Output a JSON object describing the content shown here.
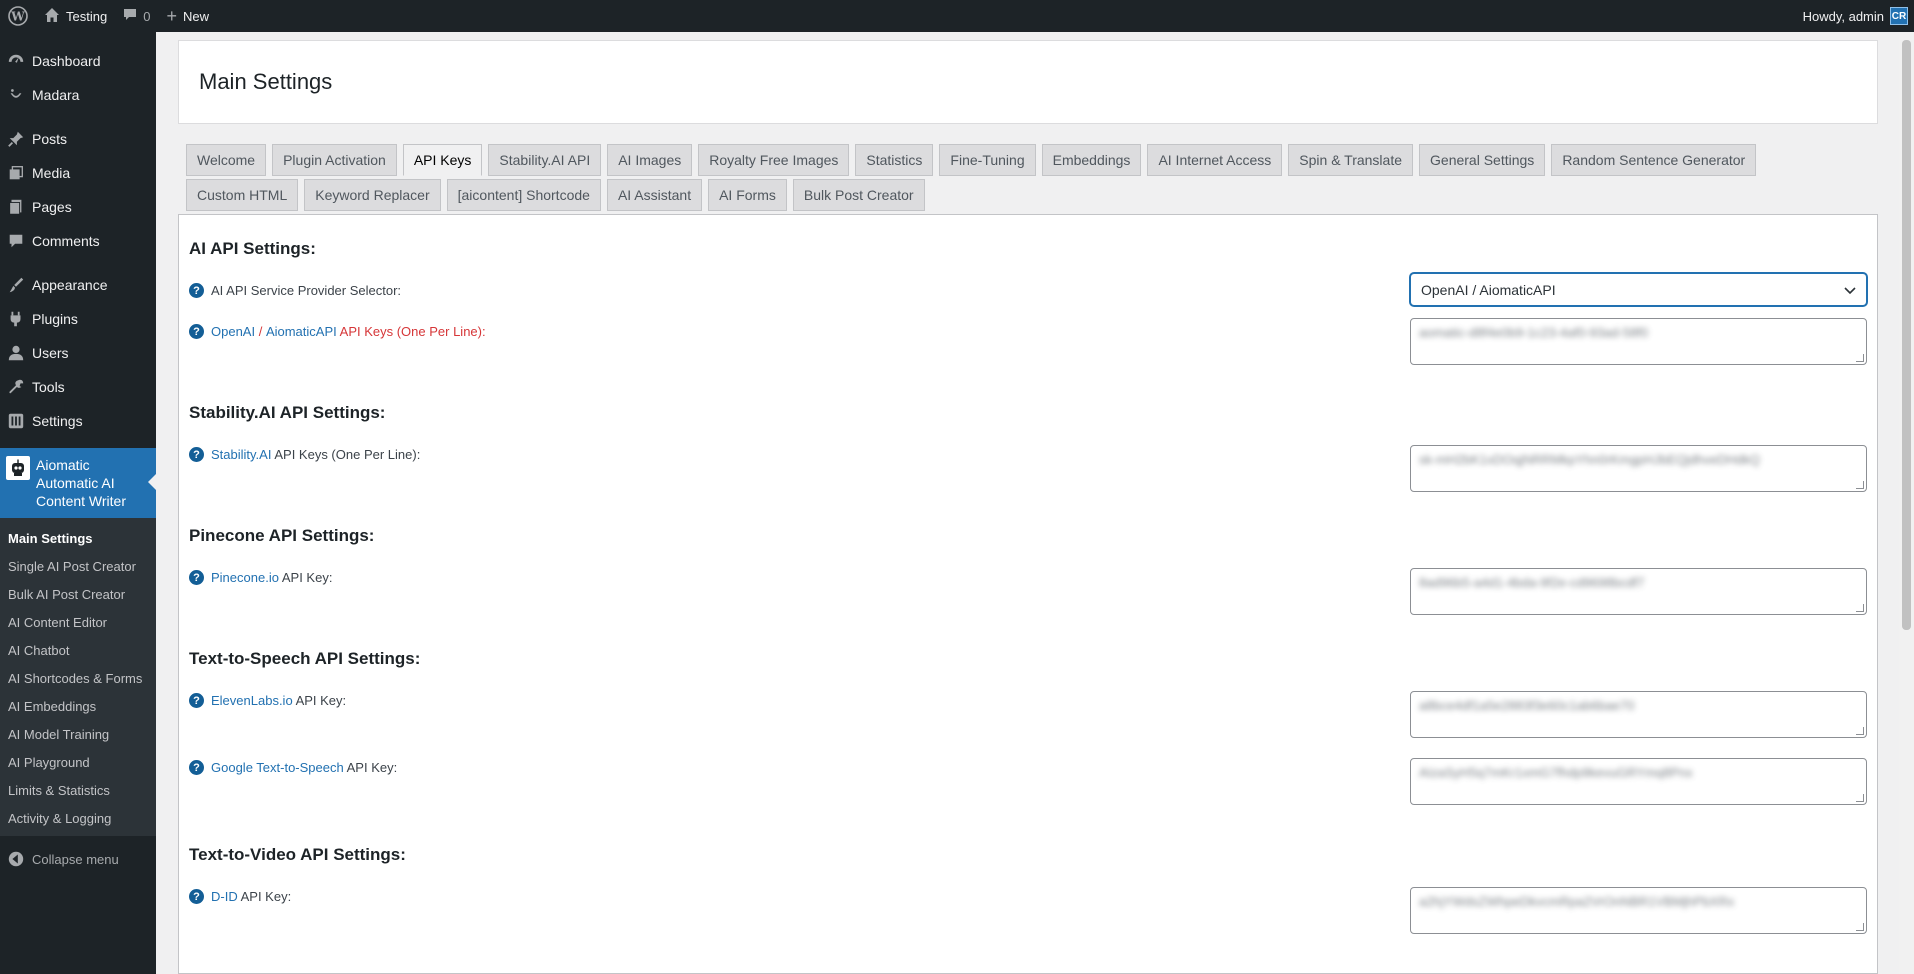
{
  "adminbar": {
    "site_name": "Testing",
    "comments_count": "0",
    "new_label": "New",
    "howdy": "Howdy, admin",
    "avatar_text": "CR"
  },
  "sidebar": {
    "items": [
      {
        "label": "Dashboard",
        "icon": "dashboard-icon"
      },
      {
        "label": "Madara",
        "icon": "madara-icon"
      },
      {
        "label": "Posts",
        "icon": "pin-icon"
      },
      {
        "label": "Media",
        "icon": "media-icon"
      },
      {
        "label": "Pages",
        "icon": "pages-icon"
      },
      {
        "label": "Comments",
        "icon": "comment-icon"
      },
      {
        "label": "Appearance",
        "icon": "brush-icon"
      },
      {
        "label": "Plugins",
        "icon": "plugin-icon"
      },
      {
        "label": "Users",
        "icon": "user-icon"
      },
      {
        "label": "Tools",
        "icon": "wrench-icon"
      },
      {
        "label": "Settings",
        "icon": "settings-icon"
      }
    ],
    "current": "Aiomatic Automatic AI Content Writer",
    "submenu": [
      "Main Settings",
      "Single AI Post Creator",
      "Bulk AI Post Creator",
      "AI Content Editor",
      "AI Chatbot",
      "AI Shortcodes & Forms",
      "AI Embeddings",
      "AI Model Training",
      "AI Playground",
      "Limits & Statistics",
      "Activity & Logging"
    ],
    "collapse": "Collapse menu"
  },
  "page": {
    "title": "Main Settings",
    "tabs": [
      "Welcome",
      "Plugin Activation",
      "API Keys",
      "Stability.AI API",
      "AI Images",
      "Royalty Free Images",
      "Statistics",
      "Fine-Tuning",
      "Embeddings",
      "AI Internet Access",
      "Spin & Translate",
      "General Settings",
      "Random Sentence Generator",
      "Custom HTML",
      "Keyword Replacer",
      "[aicontent] Shortcode",
      "AI Assistant",
      "AI Forms",
      "Bulk Post Creator"
    ],
    "active_tab": "API Keys"
  },
  "sections": {
    "ai": {
      "heading": "AI API Settings:",
      "provider_label": "AI API Service Provider Selector:",
      "provider_value": "OpenAI / AiomaticAPI",
      "keys_label_link1": "OpenAI",
      "keys_label_sep": " / ",
      "keys_label_link2": "AiomaticAPI",
      "keys_label_rest": " API Keys (One Per Line):",
      "keys_value": "aomatic-d8f4e0b9-1c23-4af0-93ad-58f0"
    },
    "stability": {
      "heading": "Stability.AI API Settings:",
      "label_link": "Stability.AI",
      "label_rest": " API Keys (One Per Line):",
      "value": "sk-mH2bK1xDOqjNRRMkpYhn0rKmgpHJbEQjdhveDHdkQ"
    },
    "pinecone": {
      "heading": "Pinecone API Settings:",
      "label_link": "Pinecone.io",
      "label_rest": " API Key:",
      "value": "8ad96b5-a4d1-4bda-9f2e-cd9698bcdf7"
    },
    "tts": {
      "heading": "Text-to-Speech API Settings:",
      "eleven_link": "ElevenLabs.io",
      "eleven_rest": " API Key:",
      "eleven_value": "a8bce4df1a5e2883f3e60c1ab6bae70",
      "google_link": "Google Text-to-Speech",
      "google_rest": " API Key:",
      "google_value": "AIzaSyH5q7mKr1xmG7fhdp9kevuGRYmq8Pnx"
    },
    "ttv": {
      "heading": "Text-to-Video API Settings:",
      "did_link": "D-ID",
      "did_rest": " API Key:",
      "did_value": "a2hjYWdsZWhpeDkvcmRpa2VrOnNBR1VBMjhPbXRx"
    }
  }
}
